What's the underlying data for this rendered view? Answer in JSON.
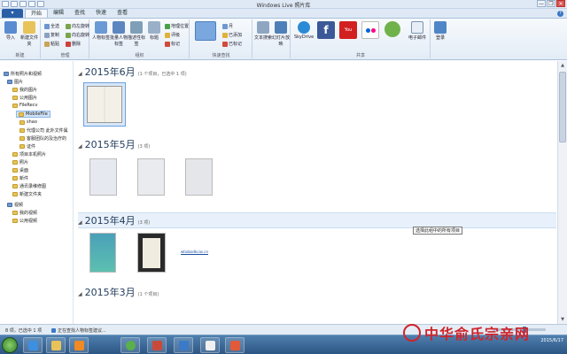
{
  "window": {
    "title": "Windows Live 照片库",
    "controls": [
      "—",
      "❐",
      "✕"
    ]
  },
  "menu": {
    "app_button": "▾",
    "tabs": [
      "开始",
      "编辑",
      "查找",
      "快速",
      "查看"
    ],
    "active_tab": "开始"
  },
  "ribbon": {
    "groups": [
      {
        "label": "新建",
        "buttons": [
          {
            "label": "导入"
          },
          {
            "label": "新建文件夹"
          }
        ]
      },
      {
        "label": "管理",
        "items": [
          "全选",
          "向左旋转",
          "复制",
          "向右旋转",
          "粘贴",
          "删除"
        ]
      },
      {
        "label": "组织",
        "items": [
          "人物标签",
          "批量人物标签",
          "描述性标签",
          "标题",
          "地理位置",
          "评级",
          "标记"
        ]
      },
      {
        "label": "快速查找",
        "items": [
          "月",
          "已添加",
          "已标记"
        ]
      },
      {
        "label": "",
        "items": [
          "文本搜索",
          "幻灯片放映"
        ]
      },
      {
        "label": "共享",
        "items": [
          "SkyDrive",
          "Facebook",
          "YouTube",
          "Flickr",
          "群组",
          "电子邮件"
        ]
      },
      {
        "label": "",
        "items": [
          "登录"
        ]
      }
    ]
  },
  "sidebar": {
    "items": [
      {
        "label": "所有照片和视频"
      },
      {
        "label": "图片"
      },
      {
        "label": "我的图片"
      },
      {
        "label": "公用图片"
      },
      {
        "label": "FileRecv"
      },
      {
        "label": "MobileFile"
      },
      {
        "label": "shao"
      },
      {
        "label": "代理公司 此外文件属"
      },
      {
        "label": "客服团队的及治疗的"
      },
      {
        "label": "证件"
      },
      {
        "label": "项目本机照片"
      },
      {
        "label": "照片"
      },
      {
        "label": "桌面"
      },
      {
        "label": "新件"
      },
      {
        "label": "通讯录维修图"
      },
      {
        "label": "新建文件夹"
      },
      {
        "label": "视频"
      },
      {
        "label": "我的视频"
      },
      {
        "label": "公用视频"
      }
    ],
    "selected": "MobileFile"
  },
  "sections": [
    {
      "date": "2015年6月",
      "count": "(1 个项目，已选中 1 项)"
    },
    {
      "date": "2015年5月",
      "count": "(3 项)"
    },
    {
      "date": "2015年4月",
      "count": "(3 项)"
    },
    {
      "date": "2015年3月",
      "count": "(1 个项目)"
    }
  ],
  "tooltip": "选择此组中的所有项目",
  "link_text": "wtiobodkcas.cn",
  "status": {
    "selection": "8 项，已选中 1 项",
    "message": "正在查找人物标签建议..."
  },
  "taskbar": {
    "tray_time": "",
    "tray_date": "2015/6/17"
  },
  "watermark": {
    "text": "中华俞氏宗亲网"
  },
  "colors": {
    "accent": "#2a5fa8",
    "watermark_red": "#d0242b",
    "taskbar": "#2c5684"
  }
}
